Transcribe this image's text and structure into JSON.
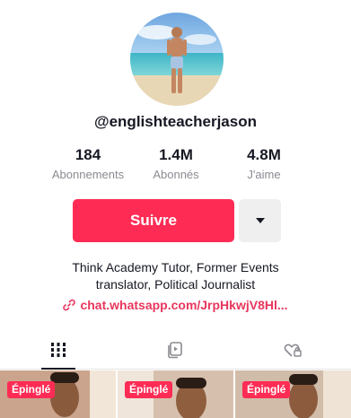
{
  "profile": {
    "username": "@englishteacherjason",
    "avatar_icon": "profile-photo-beach"
  },
  "stats": [
    {
      "value": "184",
      "label": "Abonnements"
    },
    {
      "value": "1.4M",
      "label": "Abonnés"
    },
    {
      "value": "4.8M",
      "label": "J'aime"
    }
  ],
  "actions": {
    "follow_label": "Suivre",
    "more_icon": "caret-down-icon",
    "accent_color": "#fe2c55"
  },
  "bio": {
    "line1": "Think Academy Tutor, Former Events",
    "line2": "translator, Political Journalist",
    "link_icon": "link-icon",
    "link_text": "chat.whatsapp.com/JrpHkwjV8Hl..."
  },
  "tabs": [
    {
      "icon": "grid-icon",
      "active": true
    },
    {
      "icon": "repost-icon",
      "active": false
    },
    {
      "icon": "liked-private-icon",
      "active": false
    }
  ],
  "videos": [
    {
      "badge": "Épinglé"
    },
    {
      "badge": "Épinglé"
    },
    {
      "badge": "Épinglé"
    }
  ]
}
